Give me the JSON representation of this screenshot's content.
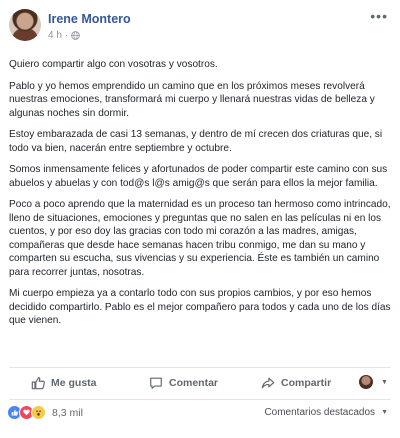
{
  "post": {
    "author": "Irene Montero",
    "time": "4 h",
    "separator": "·",
    "more": "•••",
    "paragraphs": [
      "Quiero compartir algo con vosotras y vosotros.",
      "Pablo y yo hemos emprendido un camino que en los próximos meses revolverá nuestras emociones, transformará mi cuerpo y llenará nuestras vidas de belleza y algunas noches sin dormir.",
      "Estoy embarazada de casi 13 semanas, y dentro de mí crecen dos criaturas que, si todo va bien, nacerán entre septiembre y octubre.",
      "Somos inmensamente felices y afortunados de poder compartir este camino con sus abuelos y abuelas y con tod@s l@s amig@s que serán para ellos la mejor familia.",
      "Poco a poco aprendo que la maternidad es un proceso tan hermoso como intrincado, lleno de situaciones, emociones y preguntas que no salen en las películas ni en los cuentos, y por eso doy las gracias con todo mi corazón a las madres, amigas, compañeras que desde hace semanas hacen tribu conmigo, me dan su mano y comparten su escucha, sus vivencias y su experiencia. Éste es también un camino para recorrer juntas, nosotras.",
      "Mi cuerpo empieza ya a contarlo todo con sus propios cambios, y por eso hemos decidido compartirlo. Pablo es el mejor compañero para todos y cada uno de los días que vienen."
    ]
  },
  "actions": {
    "like": "Me gusta",
    "comment": "Comentar",
    "share": "Compartir"
  },
  "reactions": {
    "count": "8,3 mil",
    "sort_label": "Comentarios destacados"
  },
  "colors": {
    "link": "#365899",
    "meta": "#90949c",
    "like": "#4a84f5",
    "love": "#f0485b",
    "wow": "#f7c84b"
  }
}
